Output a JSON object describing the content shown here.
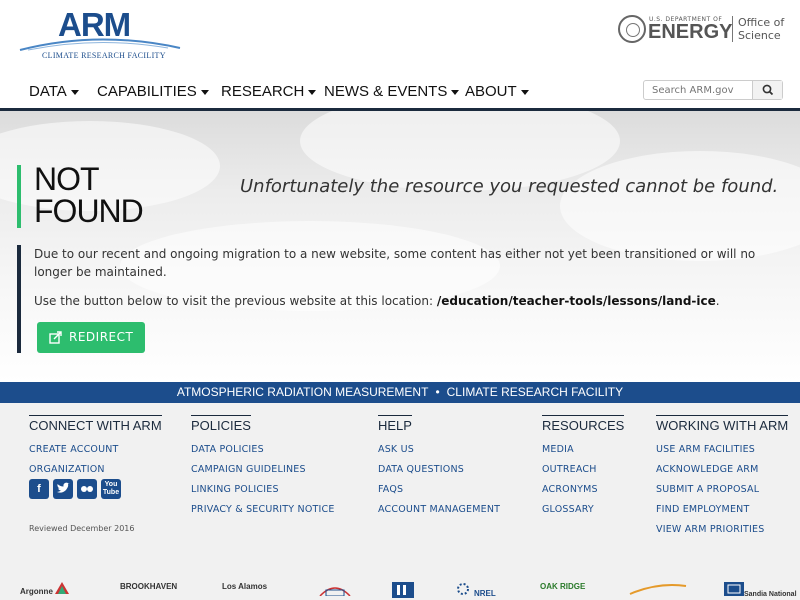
{
  "header": {
    "logo_text": "ARM",
    "logo_subtitle": "CLIMATE RESEARCH FACILITY",
    "doe_line1": "U.S. DEPARTMENT OF",
    "doe_line2": "ENERGY",
    "office_of": "Office of",
    "science": "Science"
  },
  "nav": {
    "items": [
      {
        "label": "DATA"
      },
      {
        "label": "CAPABILITIES"
      },
      {
        "label": "RESEARCH"
      },
      {
        "label": "NEWS & EVENTS"
      },
      {
        "label": "ABOUT"
      }
    ],
    "search_placeholder": "Search ARM.gov"
  },
  "main": {
    "title": "NOT FOUND",
    "message": "Unfortunately the resource you requested cannot be found.",
    "migration_p1": "Due to our recent and ongoing migration to a new website, some content has either not yet been transitioned or will no longer be maintained.",
    "migration_p2_prefix": "Use the button below to visit the previous website at this location: ",
    "migration_path": "/education/teacher-tools/lessons/land-ice",
    "migration_p2_suffix": ".",
    "redirect_label": "REDIRECT"
  },
  "strip": {
    "left": "ATMOSPHERIC RADIATION MEASUREMENT",
    "separator": "•",
    "right": "CLIMATE RESEARCH FACILITY"
  },
  "footer": {
    "columns": [
      {
        "heading": "CONNECT WITH ARM",
        "links": [
          "CREATE ACCOUNT",
          "ORGANIZATION"
        ]
      },
      {
        "heading": "POLICIES",
        "links": [
          "DATA POLICIES",
          "CAMPAIGN GUIDELINES",
          "LINKING POLICIES",
          "PRIVACY & SECURITY NOTICE"
        ]
      },
      {
        "heading": "HELP",
        "links": [
          "ASK US",
          "DATA QUESTIONS",
          "FAQS",
          "ACCOUNT MANAGEMENT"
        ]
      },
      {
        "heading": "RESOURCES",
        "links": [
          "MEDIA",
          "OUTREACH",
          "ACRONYMS",
          "GLOSSARY"
        ]
      },
      {
        "heading": "WORKING WITH ARM",
        "links": [
          "USE ARM FACILITIES",
          "ACKNOWLEDGE ARM",
          "SUBMIT A PROPOSAL",
          "FIND EMPLOYMENT",
          "VIEW ARM PRIORITIES"
        ]
      }
    ],
    "social": {
      "youtube_line1": "You",
      "youtube_line2": "Tube"
    },
    "reviewed": "Reviewed December 2016",
    "labs": [
      "Argonne",
      "BROOKHAVEN",
      "Los Alamos",
      "NREL",
      "OAK RIDGE",
      "Sandia National"
    ]
  },
  "colors": {
    "brand_blue": "#1c4d8c",
    "dark_navy": "#1b2a3d",
    "accent_green": "#2dbd6e"
  }
}
